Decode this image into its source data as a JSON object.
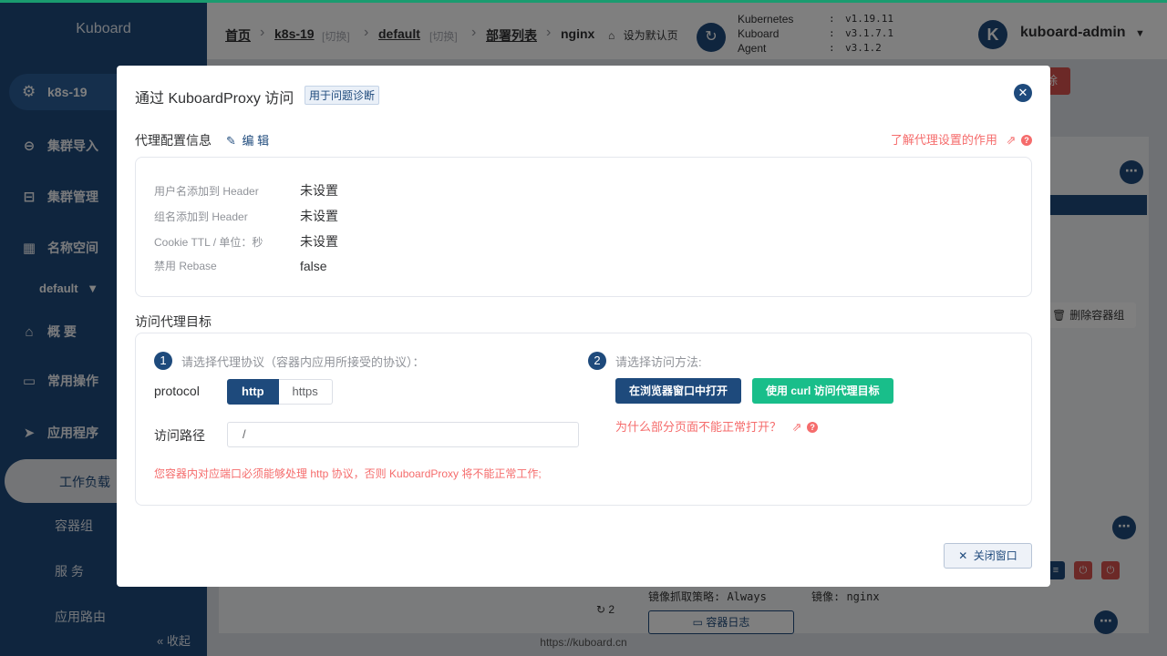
{
  "sidebar": {
    "brand": "Kuboard",
    "cluster": "k8s-19",
    "items": [
      {
        "label": "集群导入"
      },
      {
        "label": "集群管理"
      },
      {
        "label": "名称空间"
      }
    ],
    "namespace": "default",
    "sub_items": [
      {
        "label": "概 要"
      },
      {
        "label": "常用操作"
      },
      {
        "label": "应用程序"
      }
    ],
    "workload": "工作负载",
    "pods": "容器组",
    "services": "服 务",
    "ingress": "应用路由",
    "collapse": "收起"
  },
  "header": {
    "breadcrumb": {
      "home": "首页",
      "cluster": "k8s-19",
      "switch1": "[切换]",
      "namespace": "default",
      "switch2": "[切换]",
      "deployments": "部署列表",
      "current": "nginx"
    },
    "set_default": "设为默认页",
    "versions": [
      {
        "name": "Kubernetes",
        "value": "v1.19.11"
      },
      {
        "name": "Kuboard",
        "value": "v3.1.7.1"
      },
      {
        "name": "Agent",
        "value": "v3.1.2"
      }
    ],
    "avatar_letter": "K",
    "user": "kuboard-admin"
  },
  "background": {
    "delete_pod": "删除容器组",
    "pull_policy": "镜像抓取策略: Always",
    "image": "镜像: nginx",
    "container_log": "容器日志",
    "restart_count": "2",
    "delete_fragment": "除"
  },
  "modal": {
    "title": "通过 KuboardProxy 访问",
    "tag": "用于问题诊断",
    "config_title": "代理配置信息",
    "edit": "编 辑",
    "help_link": "了解代理设置的作用",
    "config": [
      {
        "label": "用户名添加到 Header",
        "value": "未设置"
      },
      {
        "label": "组名添加到 Header",
        "value": "未设置"
      },
      {
        "label": "Cookie TTL / 单位：秒",
        "value": "未设置"
      },
      {
        "label": "禁用 Rebase",
        "value": "false"
      }
    ],
    "target_title": "访问代理目标",
    "step1": {
      "num": "1",
      "text": "请选择代理协议（容器内应用所接受的协议）："
    },
    "protocol_label": "protocol",
    "protocol_options": [
      "http",
      "https"
    ],
    "path_label": "访问路径",
    "path_value": "/",
    "warning": "您容器内对应端口必须能够处理 http 协议，否则 KuboardProxy 将不能正常工作;",
    "step2": {
      "num": "2",
      "text": "请选择访问方法:"
    },
    "open_browser": "在浏览器窗口中打开",
    "use_curl": "使用 curl 访问代理目标",
    "why_link": "为什么部分页面不能正常打开？",
    "close_button": "关闭窗口"
  },
  "footer_url": "https://kuboard.cn",
  "colors": {
    "primary": "#1e4a7c",
    "success": "#19be8a",
    "danger": "#f56c6c"
  }
}
